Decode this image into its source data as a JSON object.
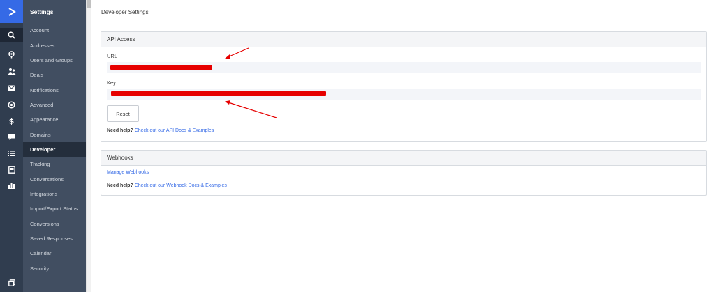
{
  "rail": {
    "colors": {
      "rail_bg": "#303d4f",
      "logo_bg": "#356ae6",
      "active_bg": "#1e2735"
    },
    "icons": [
      "logo-icon",
      "search-icon",
      "location-icon",
      "contacts-icon",
      "mail-icon",
      "target-icon",
      "dollar-icon",
      "chat-icon",
      "list-icon",
      "document-icon",
      "chart-icon",
      "window-icon"
    ]
  },
  "sidebar": {
    "title": "Settings",
    "items": [
      {
        "label": "Account"
      },
      {
        "label": "Addresses"
      },
      {
        "label": "Users and Groups"
      },
      {
        "label": "Deals"
      },
      {
        "label": "Notifications"
      },
      {
        "label": "Advanced"
      },
      {
        "label": "Appearance"
      },
      {
        "label": "Domains"
      },
      {
        "label": "Developer",
        "active": true
      },
      {
        "label": "Tracking"
      },
      {
        "label": "Conversations"
      },
      {
        "label": "Integrations"
      },
      {
        "label": "Import/Export Status"
      },
      {
        "label": "Conversions"
      },
      {
        "label": "Saved Responses"
      },
      {
        "label": "Calendar"
      },
      {
        "label": "Security"
      }
    ]
  },
  "header": {
    "title": "Developer Settings"
  },
  "api_access": {
    "title": "API Access",
    "url_label": "URL",
    "url_value": "",
    "key_label": "Key",
    "key_value": "",
    "reset_label": "Reset",
    "help_prefix": "Need help?",
    "help_link": "Check out our API Docs & Examples"
  },
  "webhooks": {
    "title": "Webhooks",
    "manage_link": "Manage Webhooks",
    "help_prefix": "Need help?",
    "help_link": "Check out our Webhook Docs & Examples"
  },
  "colors": {
    "link": "#356ae6",
    "redaction": "#e60000",
    "arrow": "#e60000",
    "field_bg": "#f3f5f9"
  }
}
